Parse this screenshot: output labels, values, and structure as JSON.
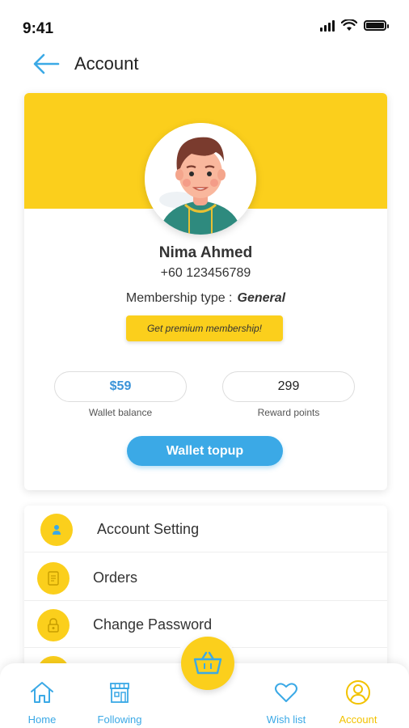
{
  "status_bar": {
    "time": "9:41"
  },
  "header": {
    "title": "Account"
  },
  "profile": {
    "name": "Nima Ahmed",
    "phone": "+60 123456789",
    "membership_label": "Membership type :",
    "membership_value": "General",
    "premium_button": "Get premium membership!",
    "wallet_value": "$59",
    "wallet_label": "Wallet balance",
    "reward_value": "299",
    "reward_label": "Reward points",
    "topup_button": "Wallet topup"
  },
  "menu": {
    "items": [
      {
        "label": "Account Setting",
        "icon": "user-icon"
      },
      {
        "label": "Orders",
        "icon": "document-icon"
      },
      {
        "label": "Change Password",
        "icon": "lock-icon"
      }
    ]
  },
  "bottom_nav": {
    "items": [
      {
        "label": "Home",
        "icon": "home-icon"
      },
      {
        "label": "Following",
        "icon": "store-icon"
      },
      {
        "label": "Wish list",
        "icon": "heart-icon"
      },
      {
        "label": "Account",
        "icon": "account-icon"
      }
    ],
    "cart_icon": "basket-icon"
  },
  "colors": {
    "brand_yellow": "#fbcf1c",
    "brand_blue": "#3ba9e6",
    "active_nav": "#f2c200"
  }
}
